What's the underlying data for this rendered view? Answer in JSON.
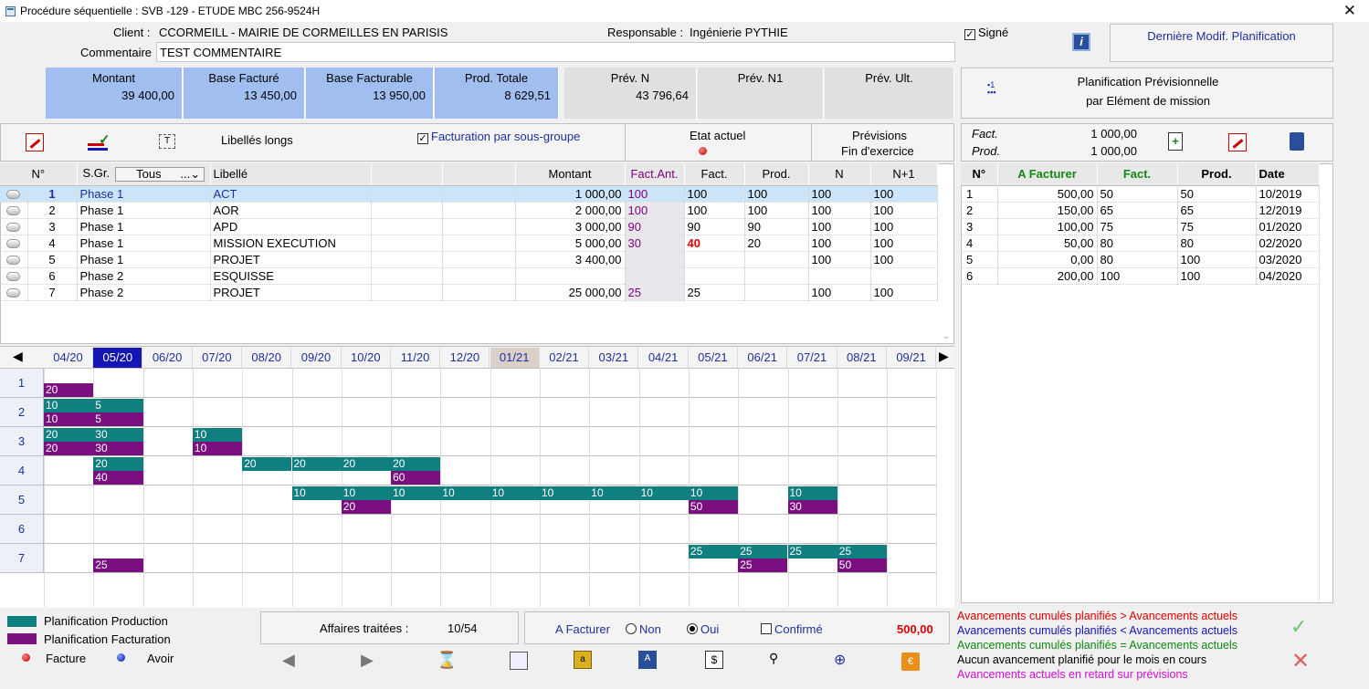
{
  "window": {
    "title": "Procédure séquentielle : SVB -129 - ETUDE MBC 256-9524H",
    "close": "✕"
  },
  "header": {
    "client_label": "Client :",
    "client_value": "CCORMEILL - MAIRIE DE CORMEILLES EN PARISIS",
    "resp_label": "Responsable :",
    "resp_value": "Ingénierie PYTHIE",
    "comment_label": "Commentaire",
    "comment_value": "TEST COMMENTAIRE",
    "signe_label": "Signé",
    "last_modif": "Dernière Modif. Planification"
  },
  "summary": [
    {
      "h": "Montant",
      "v": "39 400,00"
    },
    {
      "h": "Base Facturé",
      "v": "13 450,00"
    },
    {
      "h": "Base Facturable",
      "v": "13 950,00"
    },
    {
      "h": "Prod. Totale",
      "v": "8 629,51"
    },
    {
      "h": "Prév. N",
      "v": "43 796,64"
    },
    {
      "h": "Prév. N1",
      "v": ""
    },
    {
      "h": "Prév. Ult.",
      "v": ""
    }
  ],
  "plan_prev": {
    "line1": "Planification Prévisionnelle",
    "line2": "par Elément de mission"
  },
  "toolbar": {
    "libelles": "Libellés longs",
    "facturation": "Facturation par sous-groupe",
    "etat": "Etat actuel",
    "previsions1": "Prévisions",
    "previsions2": "Fin d'exercice"
  },
  "table": {
    "headers": [
      "N°",
      "S.Gr.",
      "Tous",
      "Libellé",
      "",
      "",
      "Montant",
      "Fact.Ant.",
      "Fact.",
      "Prod.",
      "N",
      "N+1"
    ],
    "rows": [
      {
        "n": "1",
        "sg": "Phase 1",
        "lib": "ACT",
        "montant": "1 000,00",
        "fa": "100",
        "fact": "100",
        "prod": "100",
        "N": "100",
        "N1": "100"
      },
      {
        "n": "2",
        "sg": "Phase 1",
        "lib": "AOR",
        "montant": "2 000,00",
        "fa": "100",
        "fact": "100",
        "prod": "100",
        "N": "100",
        "N1": "100"
      },
      {
        "n": "3",
        "sg": "Phase 1",
        "lib": "APD",
        "montant": "3 000,00",
        "fa": "90",
        "fact": "90",
        "prod": "90",
        "N": "100",
        "N1": "100"
      },
      {
        "n": "4",
        "sg": "Phase 1",
        "lib": "MISSION EXECUTION",
        "montant": "5 000,00",
        "fa": "30",
        "fact": "40",
        "prod": "20",
        "N": "100",
        "N1": "100"
      },
      {
        "n": "5",
        "sg": "Phase 1",
        "lib": "PROJET",
        "montant": "3 400,00",
        "fa": "",
        "fact": "",
        "prod": "",
        "N": "100",
        "N1": "100"
      },
      {
        "n": "6",
        "sg": "Phase 2",
        "lib": "ESQUISSE",
        "montant": "",
        "fa": "",
        "fact": "",
        "prod": "",
        "N": "",
        "N1": ""
      },
      {
        "n": "7",
        "sg": "Phase 2",
        "lib": "PROJET",
        "montant": "25 000,00",
        "fa": "25",
        "fact": "25",
        "prod": "",
        "N": "100",
        "N1": "100"
      }
    ]
  },
  "right": {
    "fact_label": "Fact.",
    "fact_value": "1 000,00",
    "prod_label": "Prod.",
    "prod_value": "1 000,00",
    "headers": [
      "N°",
      "A Facturer",
      "Fact.",
      "Prod.",
      "Date"
    ],
    "rows": [
      {
        "n": "1",
        "af": "500,00",
        "f": "50",
        "p": "50",
        "d": "10/2019"
      },
      {
        "n": "2",
        "af": "150,00",
        "f": "65",
        "p": "65",
        "d": "12/2019"
      },
      {
        "n": "3",
        "af": "100,00",
        "f": "75",
        "p": "75",
        "d": "01/2020"
      },
      {
        "n": "4",
        "af": "50,00",
        "f": "80",
        "p": "80",
        "d": "02/2020"
      },
      {
        "n": "5",
        "af": "0,00",
        "f": "80",
        "p": "100",
        "d": "03/2020"
      },
      {
        "n": "6",
        "af": "200,00",
        "f": "100",
        "p": "100",
        "d": "04/2020"
      }
    ]
  },
  "months": [
    "04/20",
    "05/20",
    "06/20",
    "07/20",
    "08/20",
    "09/20",
    "10/20",
    "11/20",
    "12/20",
    "01/21",
    "02/21",
    "03/21",
    "04/21",
    "05/21",
    "06/21",
    "07/21",
    "08/21",
    "09/21"
  ],
  "gantt_rows": [
    "1",
    "2",
    "3",
    "4",
    "5",
    "6",
    "7"
  ],
  "bars": [
    {
      "row": 0,
      "t": "fact",
      "col": 0,
      "span": 1,
      "v": "20"
    },
    {
      "row": 1,
      "t": "prod",
      "col": 0,
      "span": 1,
      "v": "10"
    },
    {
      "row": 1,
      "t": "prod",
      "col": 1,
      "span": 1,
      "v": "5"
    },
    {
      "row": 1,
      "t": "fact",
      "col": 0,
      "span": 1,
      "v": "10"
    },
    {
      "row": 1,
      "t": "fact",
      "col": 1,
      "span": 1,
      "v": "5"
    },
    {
      "row": 2,
      "t": "prod",
      "col": 0,
      "span": 1,
      "v": "20"
    },
    {
      "row": 2,
      "t": "prod",
      "col": 1,
      "span": 1,
      "v": "30"
    },
    {
      "row": 2,
      "t": "prod",
      "col": 3,
      "span": 1,
      "v": "10"
    },
    {
      "row": 2,
      "t": "fact",
      "col": 0,
      "span": 1,
      "v": "20"
    },
    {
      "row": 2,
      "t": "fact",
      "col": 1,
      "span": 1,
      "v": "30"
    },
    {
      "row": 2,
      "t": "fact",
      "col": 3,
      "span": 1,
      "v": "10"
    },
    {
      "row": 3,
      "t": "prod",
      "col": 1,
      "span": 1,
      "v": "20"
    },
    {
      "row": 3,
      "t": "prod",
      "col": 4,
      "span": 1,
      "v": "20"
    },
    {
      "row": 3,
      "t": "prod",
      "col": 5,
      "span": 1,
      "v": "20"
    },
    {
      "row": 3,
      "t": "prod",
      "col": 6,
      "span": 1,
      "v": "20"
    },
    {
      "row": 3,
      "t": "prod",
      "col": 7,
      "span": 1,
      "v": "20"
    },
    {
      "row": 3,
      "t": "fact",
      "col": 1,
      "span": 1,
      "v": "40"
    },
    {
      "row": 3,
      "t": "fact",
      "col": 7,
      "span": 1,
      "v": "60"
    },
    {
      "row": 4,
      "t": "prod",
      "col": 5,
      "span": 1,
      "v": "10"
    },
    {
      "row": 4,
      "t": "prod",
      "col": 6,
      "span": 1,
      "v": "10"
    },
    {
      "row": 4,
      "t": "prod",
      "col": 7,
      "span": 1,
      "v": "10"
    },
    {
      "row": 4,
      "t": "prod",
      "col": 8,
      "span": 1,
      "v": "10"
    },
    {
      "row": 4,
      "t": "prod",
      "col": 9,
      "span": 1,
      "v": "10"
    },
    {
      "row": 4,
      "t": "prod",
      "col": 10,
      "span": 1,
      "v": "10"
    },
    {
      "row": 4,
      "t": "prod",
      "col": 11,
      "span": 1,
      "v": "10"
    },
    {
      "row": 4,
      "t": "prod",
      "col": 12,
      "span": 1,
      "v": "10"
    },
    {
      "row": 4,
      "t": "prod",
      "col": 13,
      "span": 1,
      "v": "10"
    },
    {
      "row": 4,
      "t": "prod",
      "col": 15,
      "span": 1,
      "v": "10"
    },
    {
      "row": 4,
      "t": "fact",
      "col": 6,
      "span": 1,
      "v": "20"
    },
    {
      "row": 4,
      "t": "fact",
      "col": 13,
      "span": 1,
      "v": "50"
    },
    {
      "row": 4,
      "t": "fact",
      "col": 15,
      "span": 1,
      "v": "30"
    },
    {
      "row": 6,
      "t": "prod",
      "col": 13,
      "span": 1,
      "v": "25"
    },
    {
      "row": 6,
      "t": "prod",
      "col": 14,
      "span": 1,
      "v": "25"
    },
    {
      "row": 6,
      "t": "prod",
      "col": 15,
      "span": 1,
      "v": "25"
    },
    {
      "row": 6,
      "t": "prod",
      "col": 16,
      "span": 1,
      "v": "25"
    },
    {
      "row": 6,
      "t": "fact",
      "col": 1,
      "span": 1,
      "v": "25"
    },
    {
      "row": 6,
      "t": "fact",
      "col": 14,
      "span": 1,
      "v": "25"
    },
    {
      "row": 6,
      "t": "fact",
      "col": 16,
      "span": 1,
      "v": "50"
    }
  ],
  "footer": {
    "legend_prod": "Planification Production",
    "legend_fact": "Planification Facturation",
    "facture": "Facture",
    "avoir": "Avoir",
    "affaires_label": "Affaires traitées :",
    "affaires_value": "10/54",
    "a_facturer": "A Facturer",
    "non": "Non",
    "oui": "Oui",
    "confirme": "Confirmé",
    "amount": "500,00"
  },
  "messages": [
    {
      "t": "Avancements cumulés planifiés > Avancements actuels",
      "c": "#e00000"
    },
    {
      "t": "Avancements cumulés planifiés < Avancements actuels",
      "c": "#1515b4"
    },
    {
      "t": "Avancements cumulés planifiés = Avancements actuels",
      "c": "#118811"
    },
    {
      "t": "Aucun avancement planifié pour le mois en cours",
      "c": "#000000"
    },
    {
      "t": "Avancements actuels en retard sur prévisions",
      "c": "#d010d0"
    }
  ],
  "colors": {
    "prod": "#0f7f7f",
    "fact": "#7a0f7f",
    "selected": "#cce4f7",
    "accent": "#1515b4"
  }
}
